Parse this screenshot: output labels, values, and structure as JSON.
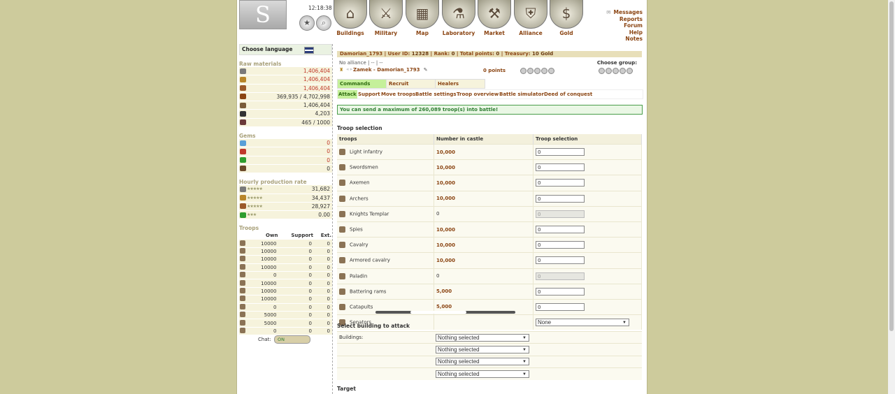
{
  "header": {
    "clock": "12:18:38",
    "nav": [
      {
        "label": "Buildings",
        "icon": "castle-icon",
        "glyph": "⌂"
      },
      {
        "label": "Military",
        "icon": "crossed-swords-icon",
        "glyph": "⚔"
      },
      {
        "label": "Map",
        "icon": "map-scroll-icon",
        "glyph": "▦"
      },
      {
        "label": "Laboratory",
        "icon": "flask-icon",
        "glyph": "⚗"
      },
      {
        "label": "Market",
        "icon": "hammer-icon",
        "glyph": "⚒"
      },
      {
        "label": "Alliance",
        "icon": "shield-icon",
        "glyph": "⛨"
      },
      {
        "label": "Gold",
        "icon": "gold-coin-icon",
        "glyph": "$"
      }
    ],
    "links": [
      "Messages",
      "Reports",
      "Forum",
      "Help",
      "Notes"
    ]
  },
  "sidebar": {
    "choose_language": "Choose language",
    "raw_materials_title": "Raw materials",
    "raw_materials": [
      "1,406,404",
      "1,406,404",
      "1,406,404",
      "369,935 / 4,702,998",
      "1,406,404",
      "4,203",
      "465 / 1000"
    ],
    "gems_title": "Gems",
    "gems": [
      "0",
      "0",
      "0",
      "0"
    ],
    "hourly_title": "Hourly production rate",
    "hourly": [
      "31,682",
      "34,437",
      "28,927",
      "0.00"
    ],
    "troops_title": "Troops",
    "troop_headers": [
      "Own",
      "Support",
      "Ext."
    ],
    "troop_rows": [
      [
        "10000",
        "0",
        "0"
      ],
      [
        "10000",
        "0",
        "0"
      ],
      [
        "10000",
        "0",
        "0"
      ],
      [
        "10000",
        "0",
        "0"
      ],
      [
        "0",
        "0",
        "0"
      ],
      [
        "10000",
        "0",
        "0"
      ],
      [
        "10000",
        "0",
        "0"
      ],
      [
        "10000",
        "0",
        "0"
      ],
      [
        "0",
        "0",
        "0"
      ],
      [
        "5000",
        "0",
        "0"
      ],
      [
        "5000",
        "0",
        "0"
      ],
      [
        "0",
        "0",
        "0"
      ]
    ],
    "chat_label": "Chat:",
    "chat_state": "ON"
  },
  "main": {
    "info": {
      "user": "Damorian_1793",
      "user_id_label": "User ID:",
      "user_id": "12328",
      "rank_label": "Rank:",
      "rank": "0",
      "points_label": "Total points:",
      "points": "0",
      "treasury_label": "Treasury:",
      "treasury": "10 Gold"
    },
    "alliance": "No alliance | -- | --",
    "castle_name": "Zamek - Damorian_1793",
    "castle_points": "0 points",
    "choose_group": "Choose group:",
    "tabs": [
      "Commands",
      "Recruit",
      "Healers"
    ],
    "subtabs": [
      "Attack",
      "Support",
      "Move troops",
      "Battle settings",
      "Troop overview",
      "Battle simulator",
      "Deed of conquest"
    ],
    "notice": "You can send a maximum of 260,089 troop(s) into battle!",
    "troop_selection_title": "Troop selection",
    "columns": [
      "troops",
      "Number in castle",
      "Troop selection"
    ],
    "troops": [
      {
        "name": "Light infantry",
        "count": "10,000",
        "sel": "0",
        "enabled": true
      },
      {
        "name": "Swordsmen",
        "count": "10,000",
        "sel": "0",
        "enabled": true
      },
      {
        "name": "Axemen",
        "count": "10,000",
        "sel": "0",
        "enabled": true
      },
      {
        "name": "Archers",
        "count": "10,000",
        "sel": "0",
        "enabled": true
      },
      {
        "name": "Knights Templar",
        "count": "0",
        "sel": "0",
        "enabled": false
      },
      {
        "name": "Spies",
        "count": "10,000",
        "sel": "0",
        "enabled": true
      },
      {
        "name": "Cavalry",
        "count": "10,000",
        "sel": "0",
        "enabled": true
      },
      {
        "name": "Armored cavalry",
        "count": "10,000",
        "sel": "0",
        "enabled": true
      },
      {
        "name": "Paladin",
        "count": "0",
        "sel": "0",
        "enabled": false
      },
      {
        "name": "Battering rams",
        "count": "5,000",
        "sel": "0",
        "enabled": true
      },
      {
        "name": "Catapults",
        "count": "5,000",
        "sel": "0",
        "enabled": true
      },
      {
        "name": "Senators",
        "count": "",
        "sel": "None",
        "enabled": true
      }
    ],
    "building_title": "Select building to attack",
    "buildings_label": "Buildings:",
    "building_selects": [
      "Nothing selected",
      "Nothing selected",
      "Nothing selected",
      "Nothing selected"
    ],
    "target_title": "Target"
  }
}
